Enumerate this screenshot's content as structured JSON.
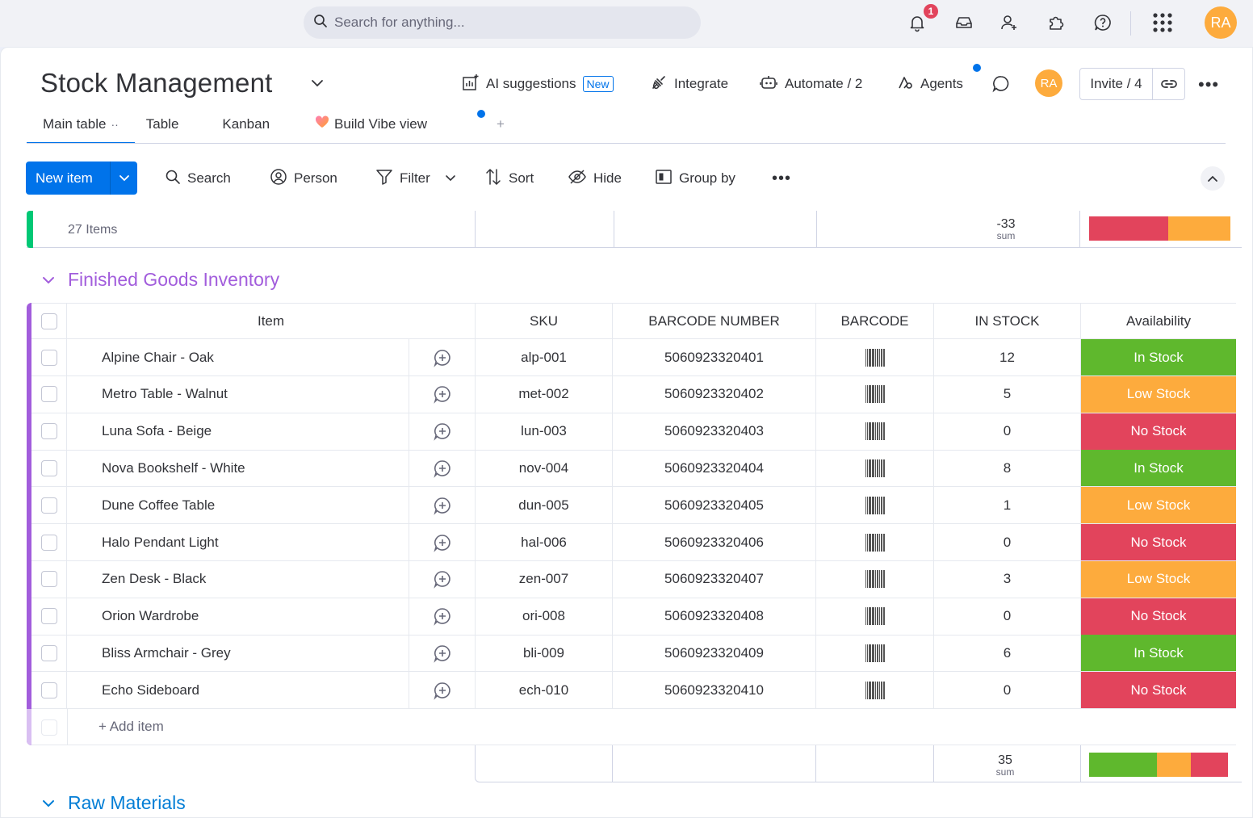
{
  "topbar": {
    "search_placeholder": "Search for anything...",
    "notification_count": "1",
    "avatar_initials": "RA"
  },
  "board": {
    "title": "Stock Management",
    "ai_suggestions_label": "AI suggestions",
    "ai_new_tag": "New",
    "integrate_label": "Integrate",
    "automate_label": "Automate / 2",
    "agents_label": "Agents",
    "avatar_initials": "RA",
    "invite_label": "Invite / 4"
  },
  "tabs": [
    {
      "label": "Main table",
      "active": true
    },
    {
      "label": "Table"
    },
    {
      "label": "Kanban"
    },
    {
      "label": "Build Vibe view"
    }
  ],
  "toolbar": {
    "new_item_label": "New item",
    "search_label": "Search",
    "person_label": "Person",
    "filter_label": "Filter",
    "sort_label": "Sort",
    "hide_label": "Hide",
    "group_by_label": "Group by"
  },
  "top_summary": {
    "items_count": "27 Items",
    "sum_value": "-33",
    "sum_label": "sum",
    "availability_bar": [
      {
        "color": "#e2445c",
        "fraction": 0.56
      },
      {
        "color": "#fdab3d",
        "fraction": 0.44
      }
    ]
  },
  "group": {
    "title": "Finished Goods Inventory",
    "color": "#a25ddc",
    "columns": {
      "item": "Item",
      "sku": "SKU",
      "barcode_number": "BARCODE NUMBER",
      "barcode": "BARCODE",
      "in_stock": "IN STOCK",
      "availability": "Availability"
    },
    "rows": [
      {
        "item": "Alpine Chair - Oak",
        "sku": "alp-001",
        "barcode_number": "5060923320401",
        "in_stock": "12",
        "availability": "In Stock",
        "color": "#5fb82d"
      },
      {
        "item": "Metro Table - Walnut",
        "sku": "met-002",
        "barcode_number": "5060923320402",
        "in_stock": "5",
        "availability": "Low Stock",
        "color": "#fdab3d"
      },
      {
        "item": "Luna Sofa - Beige",
        "sku": "lun-003",
        "barcode_number": "5060923320403",
        "in_stock": "0",
        "availability": "No Stock",
        "color": "#e2445c"
      },
      {
        "item": "Nova Bookshelf - White",
        "sku": "nov-004",
        "barcode_number": "5060923320404",
        "in_stock": "8",
        "availability": "In Stock",
        "color": "#5fb82d"
      },
      {
        "item": "Dune Coffee Table",
        "sku": "dun-005",
        "barcode_number": "5060923320405",
        "in_stock": "1",
        "availability": "Low Stock",
        "color": "#fdab3d"
      },
      {
        "item": "Halo Pendant Light",
        "sku": "hal-006",
        "barcode_number": "5060923320406",
        "in_stock": "0",
        "availability": "No Stock",
        "color": "#e2445c"
      },
      {
        "item": "Zen Desk - Black",
        "sku": "zen-007",
        "barcode_number": "5060923320407",
        "in_stock": "3",
        "availability": "Low Stock",
        "color": "#fdab3d"
      },
      {
        "item": "Orion Wardrobe",
        "sku": "ori-008",
        "barcode_number": "5060923320408",
        "in_stock": "0",
        "availability": "No Stock",
        "color": "#e2445c"
      },
      {
        "item": "Bliss Armchair - Grey",
        "sku": "bli-009",
        "barcode_number": "5060923320409",
        "in_stock": "6",
        "availability": "In Stock",
        "color": "#5fb82d"
      },
      {
        "item": "Echo Sideboard",
        "sku": "ech-010",
        "barcode_number": "5060923320410",
        "in_stock": "0",
        "availability": "No Stock",
        "color": "#e2445c"
      }
    ],
    "add_item_label": "+ Add item",
    "sum_value": "35",
    "sum_label": "sum",
    "availability_bar": [
      {
        "color": "#5fb82d",
        "fraction": 0.49
      },
      {
        "color": "#fdab3d",
        "fraction": 0.24
      },
      {
        "color": "#e2445c",
        "fraction": 0.27
      }
    ]
  },
  "group2": {
    "title": "Raw Materials",
    "color": "#037ed6"
  }
}
